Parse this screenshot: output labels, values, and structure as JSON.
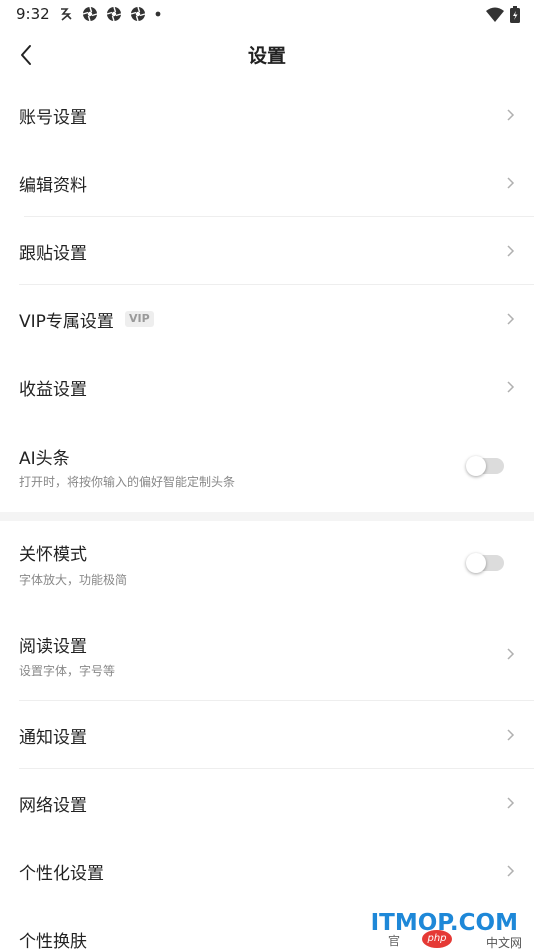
{
  "status_bar": {
    "time": "9:32",
    "icons": [
      "app-icon",
      "pinwheel-icon",
      "pinwheel-icon",
      "pinwheel-icon",
      "dot-icon"
    ],
    "right_icons": [
      "wifi-icon",
      "battery-icon"
    ]
  },
  "header": {
    "title": "设置",
    "back_icon": "chevron-left-icon"
  },
  "settings": [
    {
      "label": "账号设置",
      "control": "chevron"
    },
    {
      "label": "编辑资料",
      "control": "chevron"
    },
    {
      "label": "跟贴设置",
      "control": "chevron"
    },
    {
      "label": "VIP专属设置",
      "badge": "VIP",
      "control": "chevron"
    },
    {
      "label": "收益设置",
      "control": "chevron"
    },
    {
      "label": "AI头条",
      "subtitle": "打开时，将按你输入的偏好智能定制头条",
      "control": "toggle",
      "on": false
    },
    {
      "label": "关怀模式",
      "subtitle": "字体放大，功能极简",
      "control": "toggle",
      "on": false
    },
    {
      "label": "阅读设置",
      "subtitle": "设置字体，字号等",
      "control": "chevron"
    },
    {
      "label": "通知设置",
      "control": "chevron"
    },
    {
      "label": "网络设置",
      "control": "chevron"
    },
    {
      "label": "个性化设置",
      "control": "chevron"
    },
    {
      "label": "个性换肤",
      "control": "chevron"
    }
  ],
  "watermark": {
    "brand": "ITMOP.COM",
    "php_text": "php",
    "cn_text": "中文网",
    "left_text": "官"
  },
  "colors": {
    "background": "#ffffff",
    "text": "#222222",
    "subtext": "#888888",
    "divider": "#eeeeee",
    "watermark_blue": "#1e88d8"
  }
}
